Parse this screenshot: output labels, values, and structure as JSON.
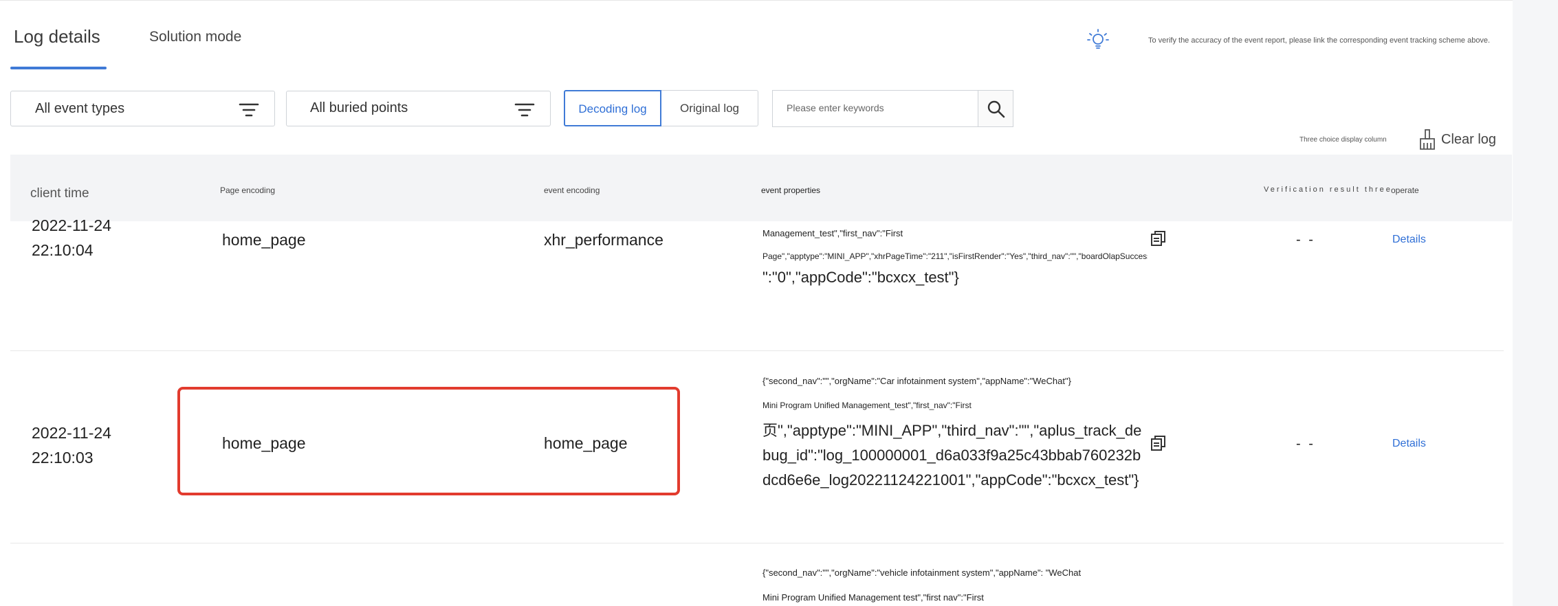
{
  "tabs": [
    {
      "label": "Log details",
      "active": true
    },
    {
      "label": "Solution mode",
      "active": false
    }
  ],
  "hint": "To verify the accuracy of the event report, please link the corresponding event tracking scheme above.",
  "filters": {
    "event_types": "All event types",
    "buried_points": "All buried points"
  },
  "log_mode": {
    "decoding": "Decoding log",
    "original": "Original log",
    "selected": "Decoding log"
  },
  "search": {
    "placeholder": "Please enter keywords",
    "value": ""
  },
  "toolbar": {
    "display_column": "Three choice display column",
    "clear_log": "Clear log"
  },
  "table": {
    "headers": {
      "client_time": "client time",
      "page_encoding": "Page encoding",
      "event_encoding": "event encoding",
      "event_properties": "event properties",
      "verification": "Verification result three",
      "operate": "operate"
    },
    "rows": [
      {
        "date": "2022-11-24",
        "time": "22:10:04",
        "page": "home_page",
        "event": "xhr_performance",
        "props": [
          "Management_test\",\"first_nav\":\"First",
          "Page\",\"apptype\":\"MINI_APP\",\"xhrPageTime\":\"211\",\"isFirstRender\":\"Yes\",\"third_nav\":\"\",\"boardOlapSuccessNum",
          "\":\"0\",\"appCode\":\"bcxcx_test\"}"
        ],
        "verification": "- -",
        "action": "Details"
      },
      {
        "date": "2022-11-24",
        "time": "22:10:03",
        "page": "home_page",
        "event": "home_page",
        "props": [
          "{\"second_nav\":\"\",\"orgName\":\"Car infotainment system\",\"appName\":\"WeChat\"}",
          "Mini Program Unified Management_test\",\"first_nav\":\"First",
          "页\",\"apptype\":\"MINI_APP\",\"third_nav\":\"\",\"aplus_track_debug_id\":\"log_100000001_d6a033f9a25c43bbab760232bdcd6e6e_log20221124221001\",\"appCode\":\"bcxcx_test\"}"
        ],
        "verification": "- -",
        "action": "Details"
      },
      {
        "props": [
          "{\"second_nav\":\"\",\"orgName\":\"vehicle infotainment system\",\"appName\":  \"WeChat",
          "Mini Program Unified Management test\",\"first nav\":\"First"
        ]
      }
    ]
  },
  "colors": {
    "accent": "#3f7ad6",
    "highlight": "#e23b2e"
  }
}
